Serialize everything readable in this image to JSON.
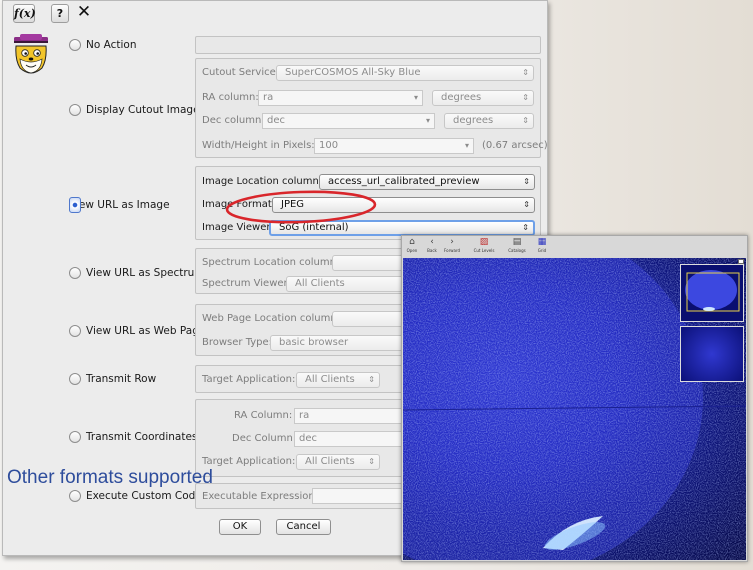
{
  "toolbar": {
    "func_label": "f(x)",
    "help_label": "?",
    "close_label": "✕"
  },
  "actions": {
    "no_action": "No Action",
    "display_cutout": "Display Cutout Image",
    "view_url_image": "View URL as Image",
    "view_url_spectrum": "View URL as Spectrum",
    "view_url_web": "View URL as Web Page",
    "transmit_row": "Transmit Row",
    "transmit_coords": "Transmit Coordinates",
    "execute_code": "Execute Custom Code"
  },
  "cutout": {
    "service_label": "Cutout Service:",
    "service_value": "SuperCOSMOS All-Sky Blue",
    "ra_label": "RA column:",
    "ra_value": "ra",
    "ra_unit": "degrees",
    "dec_label": "Dec column:",
    "dec_value": "dec",
    "dec_unit": "degrees",
    "size_label": "Width/Height in Pixels:",
    "size_value": "100",
    "size_note": "(0.67 arcsec)"
  },
  "image": {
    "location_label": "Image Location column:",
    "location_value": "access_url_calibrated_preview",
    "format_label": "Image Format:",
    "format_value": "JPEG",
    "viewer_label": "Image Viewer:",
    "viewer_value": "SoG (internal)"
  },
  "spectrum": {
    "location_label": "Spectrum Location column:",
    "viewer_label": "Spectrum Viewer:",
    "viewer_value": "All Clients"
  },
  "web": {
    "location_label": "Web Page Location column:",
    "browser_label": "Browser Type:",
    "browser_value": "basic browser"
  },
  "transmit_row": {
    "target_label": "Target Application:",
    "target_value": "All Clients"
  },
  "transmit_coords": {
    "ra_label": "RA Column:",
    "ra_value": "ra",
    "dec_label": "Dec Column:",
    "dec_value": "dec",
    "target_label": "Target Application:",
    "target_value": "All Clients"
  },
  "custom": {
    "expr_label": "Executable Expression:"
  },
  "buttons": {
    "ok": "OK",
    "cancel": "Cancel"
  },
  "annotation": "Other formats supported",
  "viewer_toolbar": [
    {
      "glyph": "⌂",
      "label": "Open"
    },
    {
      "glyph": "‹",
      "label": "Back"
    },
    {
      "glyph": "›",
      "label": "Forward"
    },
    {
      "glyph": "▨",
      "label": "Cut Levels"
    },
    {
      "glyph": "▤",
      "label": "Catalogs"
    },
    {
      "glyph": "▦",
      "label": "Grid"
    }
  ],
  "colors": {
    "annotation": "#2e4d9c",
    "highlight_circle": "#d9262b",
    "selection": "#2b5fd0"
  }
}
